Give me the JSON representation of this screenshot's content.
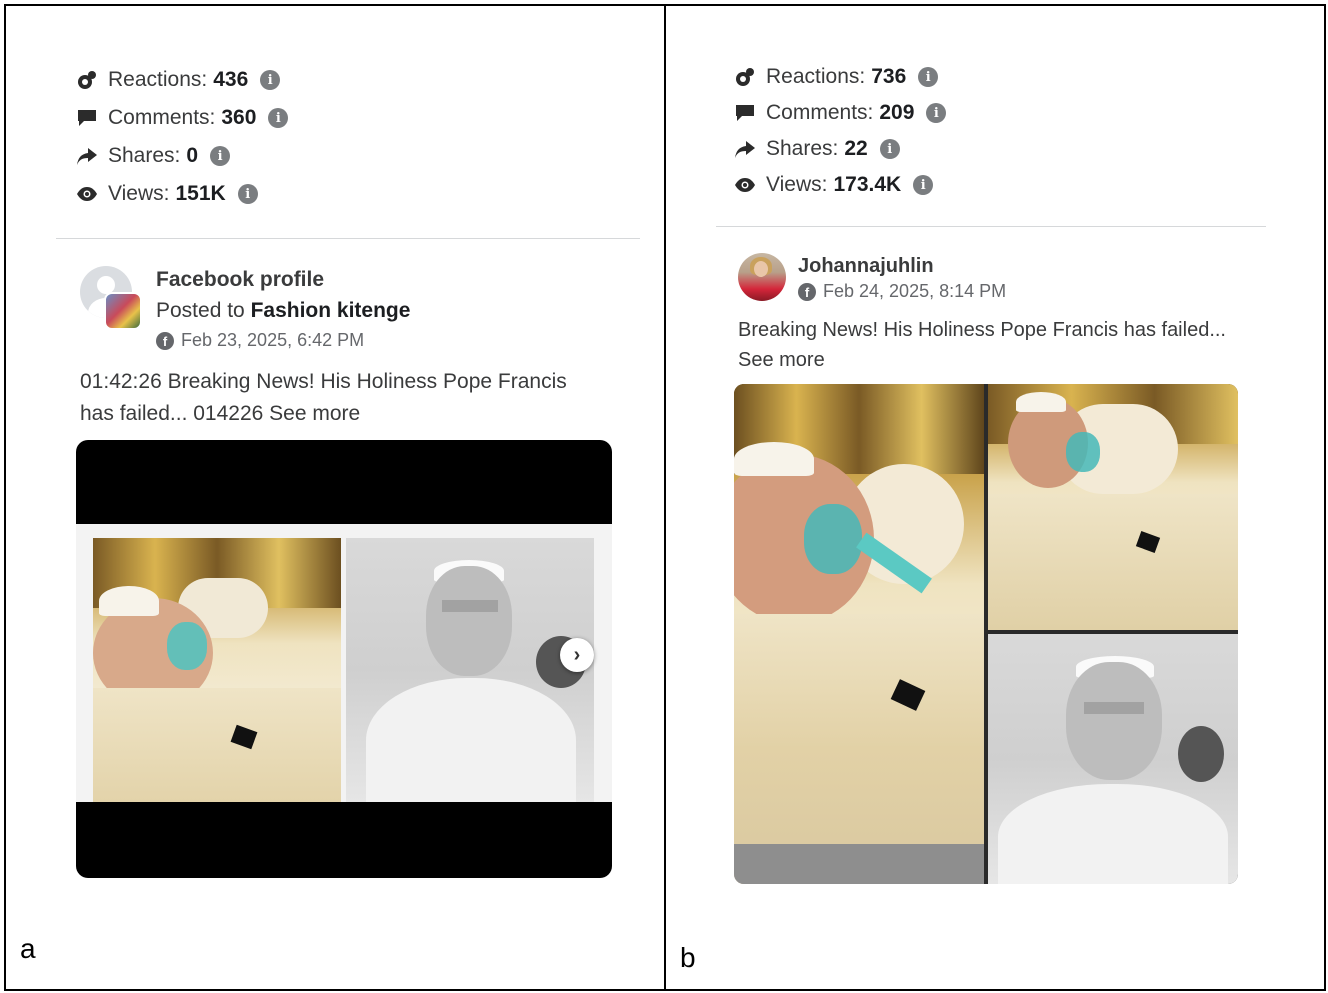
{
  "panels": [
    {
      "letter": "a",
      "stats": {
        "reactions_label": "Reactions:",
        "reactions_value": "436",
        "comments_label": "Comments:",
        "comments_value": "360",
        "shares_label": "Shares:",
        "shares_value": "0",
        "views_label": "Views:",
        "views_value": "151K"
      },
      "post": {
        "author": "Facebook profile",
        "posted_prefix": "Posted to",
        "group": "Fashion kitenge",
        "date": "Feb 23, 2025, 6:42 PM",
        "text_line1": "01:42:26 Breaking News! His Holiness Pope Francis",
        "text_line2": "has failed... 014226",
        "see_more": "See more"
      }
    },
    {
      "letter": "b",
      "stats": {
        "reactions_label": "Reactions:",
        "reactions_value": "736",
        "comments_label": "Comments:",
        "comments_value": "209",
        "shares_label": "Shares:",
        "shares_value": "22",
        "views_label": "Views:",
        "views_value": "173.4K"
      },
      "post": {
        "author": "Johannajuhlin",
        "date": "Feb 24, 2025, 8:14 PM",
        "text_line1": "Breaking News! His Holiness Pope Francis has failed...",
        "see_more": "See more"
      }
    }
  ],
  "icons": {
    "reactions": "reactions-icon",
    "comments": "comment-bubble-icon",
    "shares": "share-arrow-icon",
    "views": "eye-icon",
    "info": "info-icon",
    "facebook": "facebook-icon",
    "next": "chevron-right-icon"
  },
  "colors": {
    "text": "#3a3b3c",
    "muted": "#65676b",
    "divider": "#d6d8da"
  }
}
